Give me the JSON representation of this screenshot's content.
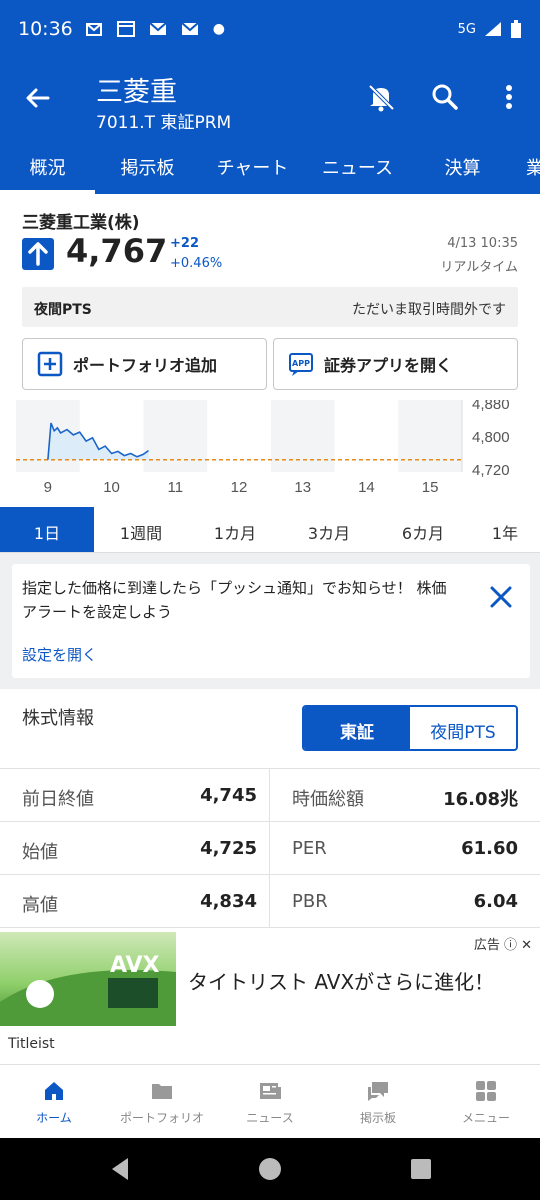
{
  "status_bar": {
    "time": "10:36",
    "network": "5G"
  },
  "header": {
    "title": "三菱重",
    "subtitle": "7011.T 東証PRM"
  },
  "tabs": [
    "概況",
    "掲示板",
    "チャート",
    "ニュース",
    "決算",
    "業"
  ],
  "stock": {
    "name": "三菱重工業(株)",
    "price": "4,767",
    "change": "+22",
    "change_pct": "+0.46%",
    "datetime": "4/13 10:35",
    "realtime": "リアルタイム"
  },
  "pts": {
    "label": "夜間PTS",
    "status": "ただいま取引時間外です"
  },
  "buttons": {
    "portfolio": "ポートフォリオ追加",
    "app": "証券アプリを開く"
  },
  "chart_data": {
    "type": "line",
    "x_ticks": [
      "9",
      "10",
      "11",
      "12",
      "13",
      "14",
      "15"
    ],
    "y_ticks": [
      "4,880",
      "4,800",
      "4,720"
    ],
    "reference_line": 4745,
    "series": [
      {
        "x": [
          9.0,
          9.05,
          9.1,
          9.15,
          9.2,
          9.3,
          9.4,
          9.5,
          9.6,
          9.7,
          9.8,
          9.9,
          10.0,
          10.1,
          10.2,
          10.3,
          10.4,
          10.5,
          10.58
        ],
        "y": [
          4745,
          4834,
          4815,
          4822,
          4810,
          4818,
          4805,
          4812,
          4790,
          4798,
          4770,
          4778,
          4760,
          4765,
          4755,
          4760,
          4752,
          4758,
          4767
        ]
      }
    ]
  },
  "period_tabs": [
    "1日",
    "1週間",
    "1カ月",
    "3カ月",
    "6カ月",
    "1年"
  ],
  "alert": {
    "text": "指定した価格に到達したら「プッシュ通知」でお知らせ！ 株価アラートを設定しよう",
    "link": "設定を開く"
  },
  "stock_info": {
    "title": "株式情報",
    "seg_on": "東証",
    "seg_off": "夜間PTS",
    "rows": [
      {
        "k1": "前日終値",
        "v1": "4,745",
        "k2": "時価総額",
        "v2": "16.08兆"
      },
      {
        "k1": "始値",
        "v1": "4,725",
        "k2": "PER",
        "v2": "61.60"
      },
      {
        "k1": "高値",
        "v1": "4,834",
        "k2": "PBR",
        "v2": "6.04"
      }
    ]
  },
  "ad": {
    "tag": "広告",
    "text": "タイトリスト AVXがさらに進化！",
    "brand": "Titleist",
    "img_text": "AVX"
  },
  "bottom_nav": [
    "ホーム",
    "ポートフォリオ",
    "ニュース",
    "掲示板",
    "メニュー"
  ]
}
